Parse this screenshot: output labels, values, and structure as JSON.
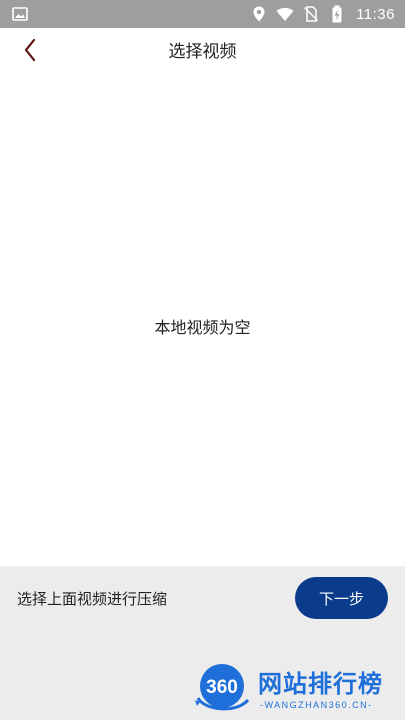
{
  "status_bar": {
    "time": "11:36",
    "icons": [
      "image-icon",
      "location-icon",
      "wifi-icon",
      "no-sim-icon",
      "battery-charging-icon"
    ],
    "background": "#9e9e9e"
  },
  "header": {
    "back_icon": "chevron-left-icon",
    "title": "选择视频"
  },
  "content": {
    "empty_message": "本地视频为空"
  },
  "bottom_bar": {
    "hint": "选择上面视频进行压缩",
    "next_label": "下一步",
    "next_color": "#0b3c8c"
  },
  "watermark": {
    "logo_text": "360",
    "name": "网站排行榜",
    "sub": "-WANGZHAN360.CN-",
    "color": "#1e6fd9"
  }
}
